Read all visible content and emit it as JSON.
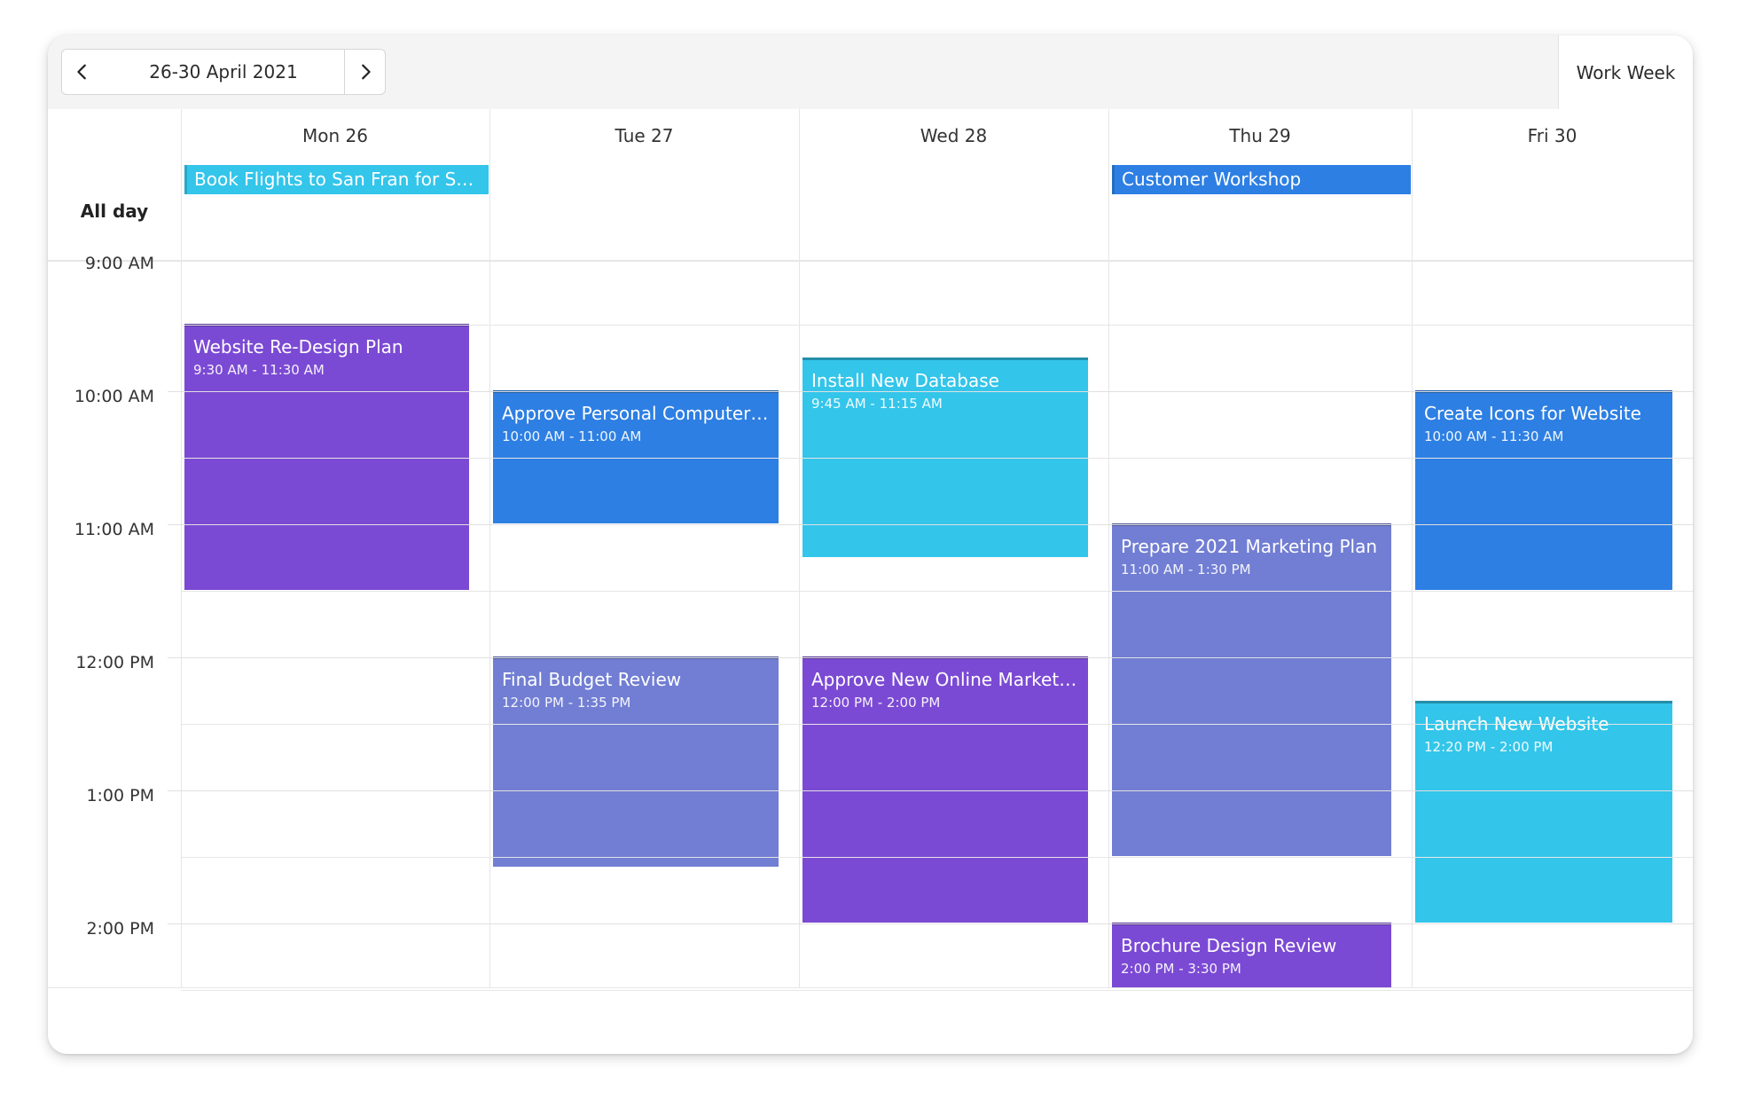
{
  "toolbar": {
    "date_range": "26-30 April 2021",
    "view_label": "Work Week",
    "prev_icon": "chevron-left-icon",
    "next_icon": "chevron-right-icon"
  },
  "allday_label": "All day",
  "days": [
    {
      "label": "Mon 26"
    },
    {
      "label": "Tue 27"
    },
    {
      "label": "Wed 28"
    },
    {
      "label": "Thu 29"
    },
    {
      "label": "Fri 30"
    }
  ],
  "times": [
    "9:00 AM",
    "10:00 AM",
    "11:00 AM",
    "12:00 PM",
    "1:00 PM",
    "2:00 PM"
  ],
  "colors": {
    "purple": "#7b4ad4",
    "blue": "#2d7fe3",
    "cyan": "#33c5ea",
    "periwinkle": "#717ed3"
  },
  "allday_events": [
    {
      "title": "Book Flights to San Fran for Sales Trip",
      "day": 0,
      "color": "#33c5ea"
    },
    {
      "title": "Customer Workshop",
      "day": 3,
      "color": "#2d7fe3"
    }
  ],
  "events": [
    {
      "title": "Website Re-Design Plan",
      "time": "9:30 AM - 11:30 AM",
      "day": 0,
      "start": 9.5,
      "end": 11.5,
      "color": "#7b4ad4"
    },
    {
      "title": "Approve Personal Computer Upgrade Plan",
      "time": "10:00 AM - 11:00 AM",
      "day": 1,
      "start": 10.0,
      "end": 11.0,
      "color": "#2d7fe3"
    },
    {
      "title": "Final Budget Review",
      "time": "12:00 PM - 1:35 PM",
      "day": 1,
      "start": 12.0,
      "end": 13.583,
      "color": "#717ed3"
    },
    {
      "title": "Install New Database",
      "time": "9:45 AM - 11:15 AM",
      "day": 2,
      "start": 9.75,
      "end": 11.25,
      "color": "#33c5ea"
    },
    {
      "title": "Approve New Online Marketing Strategy",
      "time": "12:00 PM - 2:00 PM",
      "day": 2,
      "start": 12.0,
      "end": 14.0,
      "color": "#7b4ad4"
    },
    {
      "title": "Prepare 2021 Marketing Plan",
      "time": "11:00 AM - 1:30 PM",
      "day": 3,
      "start": 11.0,
      "end": 13.5,
      "color": "#717ed3"
    },
    {
      "title": "Brochure Design Review",
      "time": "2:00 PM - 3:30 PM",
      "day": 3,
      "start": 14.0,
      "end": 15.5,
      "color": "#7b4ad4"
    },
    {
      "title": "Create Icons for Website",
      "time": "10:00 AM - 11:30 AM",
      "day": 4,
      "start": 10.0,
      "end": 11.5,
      "color": "#2d7fe3"
    },
    {
      "title": "Launch New Website",
      "time": "12:20 PM - 2:00 PM",
      "day": 4,
      "start": 12.333,
      "end": 14.0,
      "color": "#33c5ea"
    }
  ]
}
